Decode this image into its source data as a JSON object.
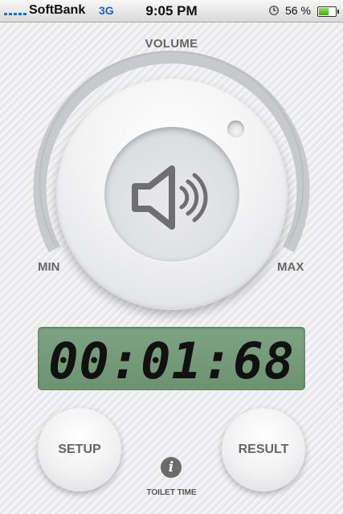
{
  "status_bar": {
    "carrier": "SoftBank",
    "network": "3G",
    "time": "9:05 PM",
    "battery_percent": "56 %",
    "battery_level": 0.56,
    "icons": [
      "signal-icon",
      "clock-icon",
      "battery-icon"
    ]
  },
  "volume": {
    "title": "VOLUME",
    "min_label": "MIN",
    "max_label": "MAX",
    "icon": "speaker-icon"
  },
  "timer": {
    "display": "00:01:68"
  },
  "buttons": {
    "setup": "SETUP",
    "result": "RESULT"
  },
  "info": {
    "icon_glyph": "i",
    "label": "TOILET TIME"
  },
  "colors": {
    "lcd_background": "#7ea383",
    "dial_track": "#c8c9cc",
    "label_gray": "#666666"
  }
}
